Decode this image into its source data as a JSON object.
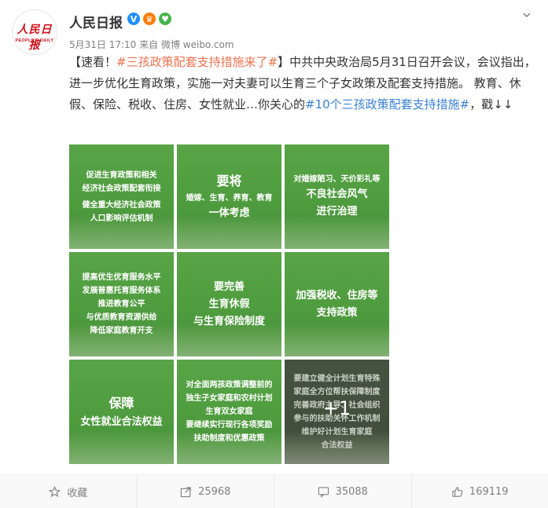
{
  "post": {
    "author": "人民日报",
    "avatar": {
      "line1": "人民日报",
      "line2": "PEOPLE'S DAILY"
    },
    "badges": [
      "verified-badge",
      "crown-badge",
      "heart-badge"
    ],
    "date": "5月31日 17:10",
    "source_label": "来自",
    "source": "微博 weibo.com",
    "content": {
      "prefix": "【速看！",
      "hashtag1": "#三孩政策配套支持措施来了#",
      "middle": "】中共中央政治局5月31日召开会议，会议指出，进一步优化生育政策，实施一对夫妻可以生育三个子女政策及配套支持措施。 教育、休假、保险、税收、住房、女性就业…你关心的",
      "hashtag2": "#10个三孩政策配套支持措施#",
      "suffix": "，戳↓↓"
    },
    "images": [
      {
        "lines": [
          "促进生育政策和相关",
          "经济社会政策配套衔接",
          "健全重大经济社会政策",
          "人口影响评估机制"
        ]
      },
      {
        "lines": [
          "要将",
          "婚嫁、生育、养育、教育",
          "一体考虑"
        ]
      },
      {
        "lines": [
          "对婚嫁陋习、天价彩礼等",
          "不良社会风气",
          "进行治理"
        ]
      },
      {
        "lines": [
          "提高优生优育服务水平",
          "发展普惠托育服务体系",
          "推进教育公平",
          "与优质教育资源供给",
          "降低家庭教育开支"
        ]
      },
      {
        "lines": [
          "要完善",
          "生育休假",
          "与生育保险制度"
        ]
      },
      {
        "lines": [
          "加强税收、住房等",
          "支持政策"
        ]
      },
      {
        "lines": [
          "保障",
          "女性就业合法权益"
        ]
      },
      {
        "lines": [
          "对全面两孩政策调整前的",
          "独生子女家庭和农村计划",
          "生育双女家庭",
          "要继续实行现行各项奖励",
          "扶助制度和优惠政策"
        ]
      },
      {
        "lines": [
          "要建立健全计划生育特殊",
          "家庭全方位帮扶保障制度",
          "完善政府主导、社会组织",
          "参与的扶助关怀工作机制",
          "维护好计划生育家庭",
          "合法权益"
        ],
        "more": "+1"
      }
    ]
  },
  "footer": {
    "favorite_label": "收藏",
    "repost_count": "25968",
    "comment_count": "35088",
    "like_count": "169119"
  },
  "colors": {
    "hashtag": "#eb7350",
    "link": "#3a7fd0",
    "tile_green": "#4f9c3f",
    "brand_red": "#d0111b"
  }
}
